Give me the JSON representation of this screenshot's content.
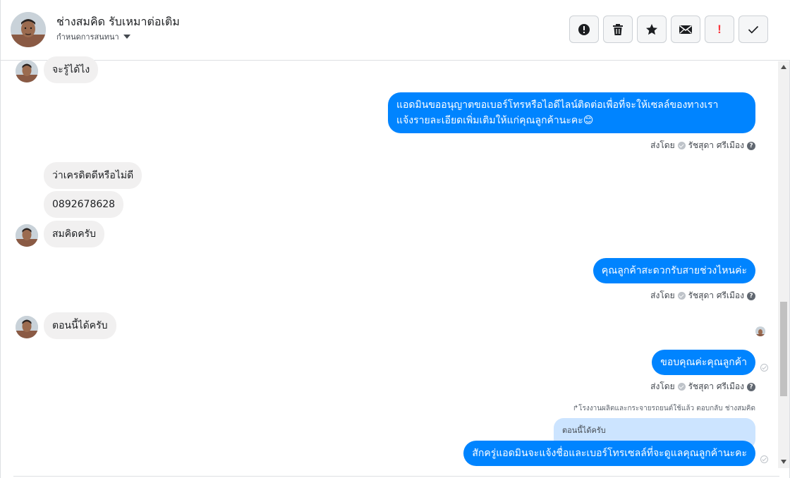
{
  "header": {
    "contact_name": "ช่างสมคิด รับเหมาต่อเติม",
    "assign_label": "กำหนดการสนทนา"
  },
  "toolbar": {
    "alert_icon": "exclamation-circle-icon",
    "delete_icon": "trash-icon",
    "star_icon": "star-icon",
    "mail_icon": "envelope-icon",
    "spam_label": "!",
    "done_icon": "check-icon"
  },
  "messages": [
    {
      "side": "in",
      "text": "จะรู้ได้ไง"
    },
    {
      "side": "out",
      "lines": [
        "แอดมินขออนุญาตขอเบอร์โทรหรือไอดีไลน์ติดต่อเพื่อที่จะให้เซลล์ของทางเรา",
        "แจ้งรายละเอียดเพิ่มเติมให้แก่คุณลูกค้านะคะ😊"
      ]
    },
    {
      "side": "in",
      "text": "ว่าเครดิตดีหรือไม่ดี"
    },
    {
      "side": "in",
      "text": "0892678628"
    },
    {
      "side": "in",
      "text": "สมคิดครับ"
    },
    {
      "side": "out",
      "text": "คุณลูกค้าสะดวกรับสายช่วงไหนค่ะ"
    },
    {
      "side": "in",
      "text": "ตอนนี้ได้ครับ"
    },
    {
      "side": "out",
      "text": "ขอบคุณค่ะคุณลูกค้า"
    },
    {
      "side": "out",
      "text": "สักครู่แอดมินจะแจ้งชื่อและเบอร์โทรเซลล์ที่จะดูแลคุณลูกค้านะคะ"
    }
  ],
  "sent_meta": {
    "prefix": "ส่งโดย",
    "agent": "รัชสุดา ศรีเมือง",
    "help": "?"
  },
  "reply": {
    "note": "↱โรงงานผลิตและกระจายรถยนต์ใช้แล้ว ตอบกลับ ช่างสมคิด",
    "quoted_text": "ตอนนี้ได้ครับ"
  },
  "colors": {
    "outgoing_bubble": "#0084ff",
    "incoming_bubble": "#f1f0f0",
    "quoted_bubble": "#cce4ff",
    "spam_red": "#fa383e"
  }
}
